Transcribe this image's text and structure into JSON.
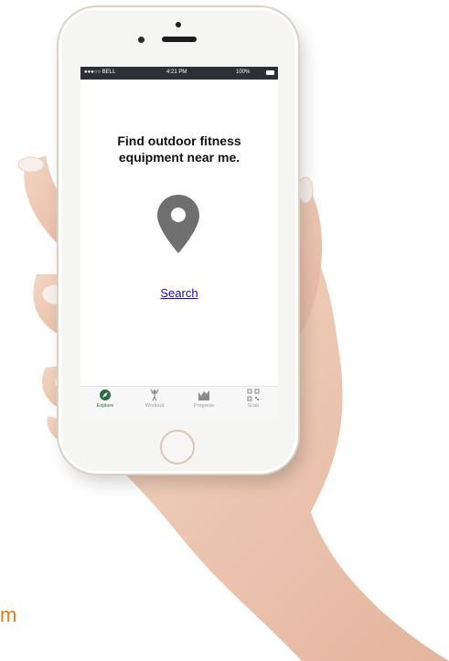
{
  "status_bar": {
    "carrier": "●●●○○ BELL",
    "time": "4:21 PM",
    "battery": "100%"
  },
  "main": {
    "title": "Find outdoor fitness equipment near me.",
    "search_link": "Search",
    "pin_icon": "location-pin-icon"
  },
  "tabs": [
    {
      "label": "Explore",
      "icon": "compass-icon",
      "active": true
    },
    {
      "label": "Workout",
      "icon": "person-exercise-icon",
      "active": false
    },
    {
      "label": "Progress",
      "icon": "bar-chart-icon",
      "active": false
    },
    {
      "label": "Scan",
      "icon": "qr-code-icon",
      "active": false
    }
  ],
  "partial_text": "m",
  "colors": {
    "accent": "#2a6b3f",
    "link": "#1a0dab",
    "pin": "#6f6f6f",
    "status_bar": "#2c2f33",
    "orange": "#e07b1a"
  }
}
